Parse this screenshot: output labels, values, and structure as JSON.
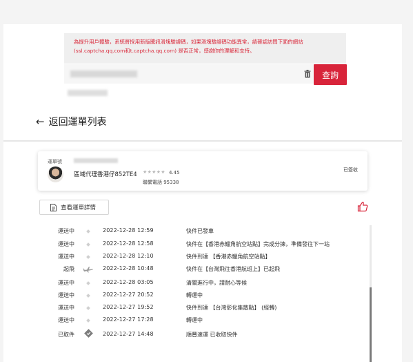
{
  "notice": {
    "line1": "為提升用戶體驗，系統將採用新版騰訊滑塊驗證碼，如果滑塊驗證碼功能異常，請確認訪問下面的網站",
    "line2": "(ssl.captcha.qq.com和t.captcha.qq.com) 是否正常，感謝你的理解和支持。"
  },
  "search": {
    "button_label": "查詢",
    "input_value": "",
    "input_redacted": true
  },
  "back": {
    "arrow": "←",
    "label": "返回運單列表"
  },
  "shipment_card": {
    "tracking_label": "運單號",
    "agent_name": "區域代理香港仔852TE4",
    "rating_stars": "★★★★★",
    "rating_value": "4.45",
    "phone_label": "聯繫電話 95338",
    "status": "已簽收"
  },
  "detail_button": {
    "label": "查看運單詳情"
  },
  "timeline": [
    {
      "status": "運送中",
      "datetime": "2022-12-28 12:59",
      "desc": "快件已發車",
      "marker": "dot"
    },
    {
      "status": "運送中",
      "datetime": "2022-12-28 12:58",
      "desc": "快件在【香港赤鱲角航空站點】完成分揀，準備發往下一站",
      "marker": "dot"
    },
    {
      "status": "運送中",
      "datetime": "2022-12-28 12:10",
      "desc": "快件到達 【香港赤鱲角航空站點】",
      "marker": "dot"
    },
    {
      "status": "起飛",
      "datetime": "2022-12-28 10:48",
      "desc": "快件在【台灣飛往香港航班上】已起飛",
      "marker": "plane"
    },
    {
      "status": "運送中",
      "datetime": "2022-12-28 03:05",
      "desc": "清關進行中，請耐心等候",
      "marker": "dot"
    },
    {
      "status": "運送中",
      "datetime": "2022-12-27 20:52",
      "desc": "轉運中",
      "marker": "dot"
    },
    {
      "status": "運送中",
      "datetime": "2022-12-27 19:52",
      "desc": "快件到達 【台灣彰化集散點】 (經轉)",
      "marker": "dot"
    },
    {
      "status": "運送中",
      "datetime": "2022-12-27 17:28",
      "desc": "轉運中",
      "marker": "dot"
    },
    {
      "status": "已取件",
      "datetime": "2022-12-27 14:48",
      "desc": "順豐速運 已收取快件",
      "marker": "pickup"
    }
  ],
  "colors": {
    "accent": "#d8243a",
    "notice_text": "#d9283a",
    "page_bg": "#ffffff",
    "outer_bg": "#f4f4f4"
  },
  "icons": {
    "back": "arrow-left-icon",
    "clear": "trash-icon",
    "detail": "document-icon",
    "feedback": "thumbs-up-icon",
    "timeline_event": "diamond-dot-icon",
    "flight": "plane-icon",
    "pickup": "pickup-icon"
  }
}
